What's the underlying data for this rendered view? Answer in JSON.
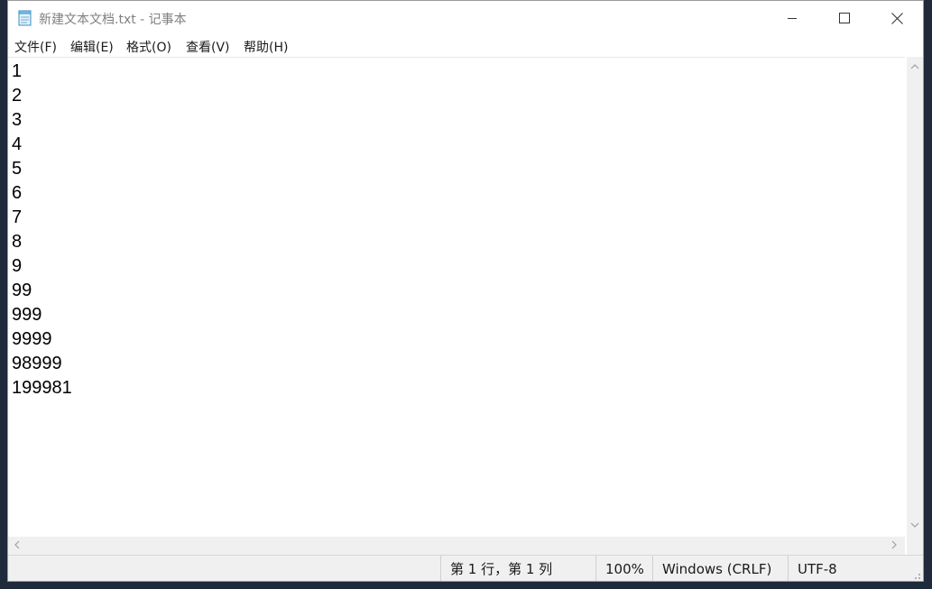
{
  "window": {
    "title": "新建文本文档.txt - 记事本",
    "app_icon": "notepad-icon",
    "controls": [
      "minimize-icon",
      "maximize-icon",
      "close-icon"
    ]
  },
  "menu": {
    "items": [
      {
        "label": "文件(F)"
      },
      {
        "label": "编辑(E)"
      },
      {
        "label": "格式(O)"
      },
      {
        "label": "查看(V)"
      },
      {
        "label": "帮助(H)"
      }
    ]
  },
  "editor": {
    "lines": [
      "1",
      "2",
      "3",
      "4",
      "5",
      "6",
      "7",
      "8",
      "9",
      "99",
      "999",
      "9999",
      "98999",
      "199981"
    ]
  },
  "status": {
    "position": "第 1 行，第 1 列",
    "zoom": "100%",
    "line_ending": "Windows (CRLF)",
    "encoding": "UTF-8"
  },
  "colors": {
    "desktop": "#1f2a3a",
    "window_bg": "#ffffff",
    "chrome_bg": "#f0f0f0",
    "title_text": "#808080"
  }
}
